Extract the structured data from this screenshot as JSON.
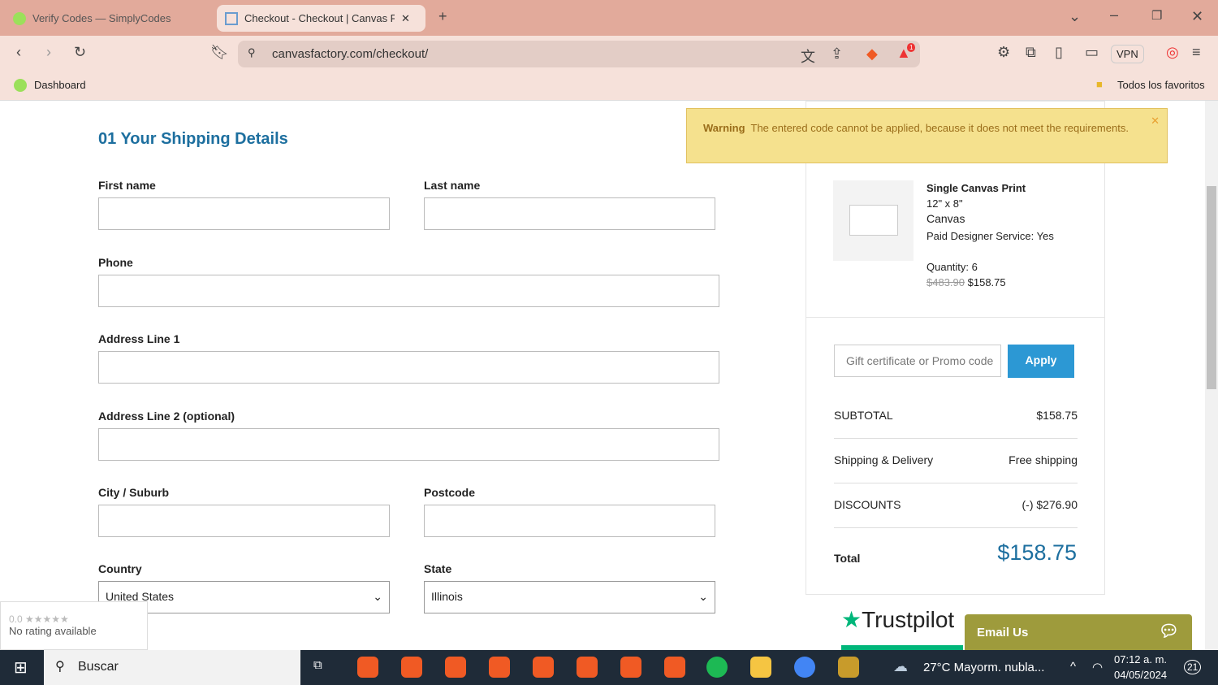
{
  "browser": {
    "tabs": [
      {
        "title": "Verify Codes — SimplyCodes"
      },
      {
        "title": "Checkout - Checkout | Canvas Fa"
      }
    ],
    "url": "canvasfactory.com/checkout/",
    "bookmark": "Dashboard",
    "all_bookmarks": "Todos los favoritos",
    "vpn": "VPN",
    "notification_count": "1"
  },
  "form": {
    "title": "01  Your Shipping Details",
    "first_name": "First name",
    "last_name": "Last name",
    "phone": "Phone",
    "address1": "Address Line 1",
    "address2": "Address Line 2 (optional)",
    "city": "City / Suburb",
    "postcode": "Postcode",
    "country": "Country",
    "country_value": "United States",
    "state": "State",
    "state_value": "Illinois"
  },
  "warning": {
    "title": "Warning",
    "message": "The entered code cannot be applied, because it does not meet the requirements."
  },
  "item": {
    "name": "Single Canvas Print",
    "size": "12\" x 8\"",
    "material": "Canvas",
    "designer": "Paid Designer Service:  Yes",
    "quantity": "Quantity: 6",
    "old_price": "$483.90",
    "price": "$158.75"
  },
  "promo": {
    "placeholder": "Gift certificate or Promo code",
    "apply": "Apply"
  },
  "totals": {
    "subtotal_label": "SUBTOTAL",
    "subtotal": "$158.75",
    "shipping_label": "Shipping & Delivery",
    "shipping": "Free shipping",
    "discounts_label": "DISCOUNTS",
    "discounts": "(-) $276.90",
    "total_label": "Total",
    "total": "$158.75"
  },
  "rating": {
    "score": "0.0 ★★★★★",
    "text": "No rating available"
  },
  "trustpilot": "Trustpilot",
  "email_us": "Email Us",
  "taskbar": {
    "search": "Buscar",
    "weather": "27°C  Mayorm. nubla...",
    "time": "07:12 a. m.",
    "date": "04/05/2024",
    "notifications": "21"
  }
}
